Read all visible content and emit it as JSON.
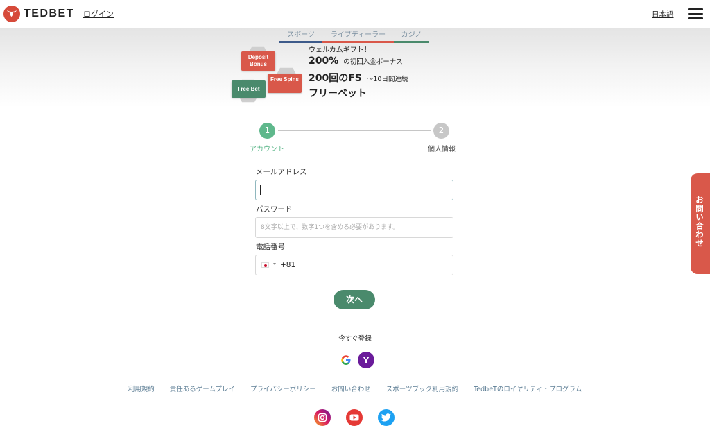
{
  "header": {
    "brand": "TEDBET",
    "login": "ログイン",
    "language": "日本語"
  },
  "banner": {
    "tabs": [
      {
        "label": "スポーツ",
        "color": "#3d5a8a"
      },
      {
        "label": "ライブディーラー",
        "color": "#d9584a"
      },
      {
        "label": "カジノ",
        "color": "#4a8a6c"
      }
    ],
    "badges": {
      "deposit": "Deposit Bonus",
      "free_bet": "Free Bet",
      "free_spins": "Free Spins"
    },
    "promo": {
      "line1": "ウェルカムギフト！",
      "bonus_big": "200%",
      "bonus_small": "の初回入金ボーナス",
      "fs_big": "200回のFS",
      "fs_small": "～10日間連続",
      "line4": "フリーベット"
    }
  },
  "stepper": {
    "steps": [
      {
        "number": "1",
        "label": "アカウント"
      },
      {
        "number": "2",
        "label": "個人情報"
      }
    ]
  },
  "form": {
    "email_label": "メールアドレス",
    "email_value": "",
    "password_label": "パスワード",
    "password_placeholder": "8文字以上で、数字1つを含める必要があります。",
    "phone_label": "電話番号",
    "phone_code": "+81",
    "next_button": "次へ"
  },
  "register_now": "今すぐ登録",
  "footer_links": [
    "利用規約",
    "責任あるゲームプレイ",
    "プライバシーポリシー",
    "お問い合わせ",
    "スポーツブック利用規約",
    "TedbeTのロイヤリティ・プログラム"
  ],
  "contact_tab": "お問い合わせ",
  "colors": {
    "brand_red": "#d64a3a",
    "accent_green": "#4a8a6c",
    "step_active": "#5fb88c",
    "step_inactive": "#c7c7c7",
    "link_blue": "#5c7d94"
  },
  "icons": {
    "social_login": [
      "google-icon",
      "yahoo-icon"
    ],
    "social_media": [
      "instagram-icon",
      "youtube-icon",
      "twitter-icon"
    ]
  }
}
